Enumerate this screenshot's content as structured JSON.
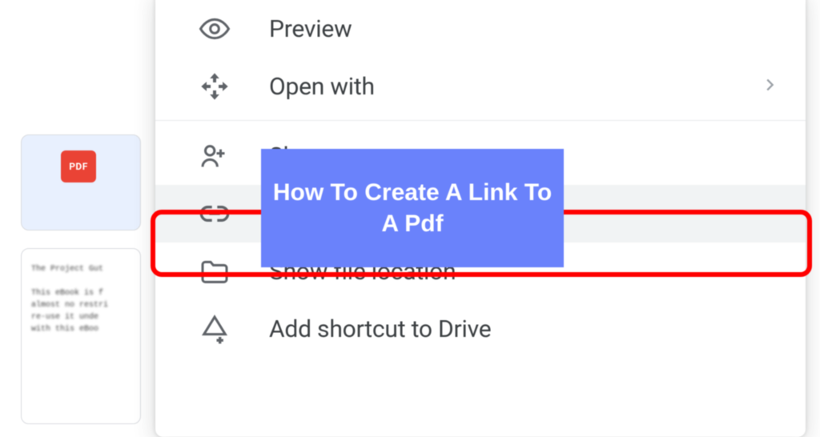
{
  "file": {
    "badge_text": "PDF",
    "doc_preview": "The Project Gut\n\nThis eBook is f\nalmost no restri\nre-use it unde\nwith this eBoo"
  },
  "menu": {
    "preview": "Preview",
    "open_with": "Open with",
    "share": "Share",
    "get_link": "Get link",
    "show_location": "Show file location",
    "add_shortcut": "Add shortcut to Drive"
  },
  "overlay": {
    "title": "How To Create A Link To A Pdf"
  }
}
